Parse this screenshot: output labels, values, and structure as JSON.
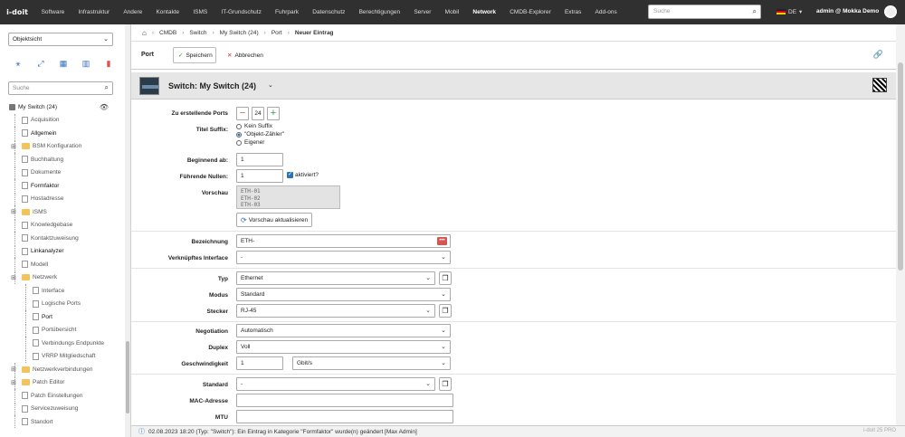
{
  "topbar": {
    "logo": "i-doit",
    "menu": [
      "Software",
      "Infrastruktur",
      "Andere",
      "Kontakte",
      "ISMS",
      "IT-Grundschutz",
      "Fuhrpark",
      "Datenschutz",
      "Berechtigungen",
      "Server",
      "Mobil",
      "Network",
      "CMDB-Explorer",
      "Extras",
      "Add-ons"
    ],
    "active": "Network",
    "search_placeholder": "Suche",
    "language": "DE",
    "user": "admin @ Mokka Demo"
  },
  "left": {
    "view_select": "Objektsicht",
    "search_placeholder": "Suche",
    "tree": [
      {
        "label": "My Switch (24)",
        "level": 0,
        "type": "root"
      },
      {
        "label": "Acquisition",
        "level": 1,
        "type": "file"
      },
      {
        "label": "Allgemein",
        "level": 1,
        "type": "file",
        "bold": true
      },
      {
        "label": "BSM Konfiguration",
        "level": 1,
        "type": "folder",
        "expand": true
      },
      {
        "label": "Buchhaltung",
        "level": 1,
        "type": "file"
      },
      {
        "label": "Dokumente",
        "level": 1,
        "type": "file"
      },
      {
        "label": "Formfaktor",
        "level": 1,
        "type": "file",
        "bold": true
      },
      {
        "label": "Hostadresse",
        "level": 1,
        "type": "file"
      },
      {
        "label": "ISMS",
        "level": 1,
        "type": "folder",
        "expand": true
      },
      {
        "label": "Knowledgebase",
        "level": 1,
        "type": "file"
      },
      {
        "label": "Kontaktzuweisung",
        "level": 1,
        "type": "file"
      },
      {
        "label": "Linkanalyzer",
        "level": 1,
        "type": "file",
        "bold": true
      },
      {
        "label": "Modell",
        "level": 1,
        "type": "file"
      },
      {
        "label": "Netzwerk",
        "level": 1,
        "type": "folder",
        "expand": true
      },
      {
        "label": "Interface",
        "level": 2,
        "type": "file"
      },
      {
        "label": "Logische Ports",
        "level": 2,
        "type": "file"
      },
      {
        "label": "Port",
        "level": 2,
        "type": "file",
        "bold": true
      },
      {
        "label": "Portübersicht",
        "level": 2,
        "type": "file"
      },
      {
        "label": "Verbindungs Endpunkte",
        "level": 2,
        "type": "file"
      },
      {
        "label": "VRRP Mitgliedschaft",
        "level": 2,
        "type": "file"
      },
      {
        "label": "Netzwerkverbindungen",
        "level": 1,
        "type": "folder",
        "expand": true
      },
      {
        "label": "Patch Editor",
        "level": 1,
        "type": "folder",
        "expand": true
      },
      {
        "label": "Patch Einstellungen",
        "level": 1,
        "type": "file"
      },
      {
        "label": "Servicezuweisung",
        "level": 1,
        "type": "file"
      },
      {
        "label": "Standort",
        "level": 1,
        "type": "file"
      }
    ]
  },
  "breadcrumb": [
    "CMDB",
    "Switch",
    "My Switch (24)",
    "Port",
    "Neuer Eintrag"
  ],
  "toolbar": {
    "title": "Port",
    "save": "Speichern",
    "cancel": "Abbrechen"
  },
  "object": {
    "title": "Switch: My Switch (24)"
  },
  "form": {
    "ports_label": "Zu erstellende Ports",
    "ports_value": "24",
    "suffix_label": "Titel Suffix:",
    "suffix_options": [
      "Kein Suffix",
      "\"Objekt-Zähler\"",
      "Eigener"
    ],
    "suffix_selected": 1,
    "begin_label": "Beginnend ab:",
    "begin_value": "1",
    "zeros_label": "Führende Nullen:",
    "zeros_value": "1",
    "zeros_check": "aktiviert?",
    "preview_label": "Vorschau",
    "preview_lines": [
      "ETH-01",
      "ETH-02",
      "ETH-03"
    ],
    "preview_button": "Vorschau aktualisieren",
    "name_label": "Bezeichnung",
    "name_value": "ETH-",
    "linked_label": "Verknüpftes Interface",
    "linked_value": "-",
    "type_label": "Typ",
    "type_value": "Ethernet",
    "mode_label": "Modus",
    "mode_value": "Standard",
    "plug_label": "Stecker",
    "plug_value": "RJ-45",
    "neg_label": "Negotiation",
    "neg_value": "Automatisch",
    "duplex_label": "Duplex",
    "duplex_value": "Voll",
    "speed_label": "Geschwindigkeit",
    "speed_value": "1",
    "speed_unit": "Gbit/s",
    "standard_label": "Standard",
    "standard_value": "-",
    "mac_label": "MAC-Adresse",
    "mac_value": "",
    "mtu_label": "MTU",
    "mtu_value": ""
  },
  "status": {
    "text": "02.08.2023 18:20 (Typ: \"Switch\"): Ein Eintrag in Kategorie \"Formfaktor\" wurde(n) geändert [Max Admin]",
    "version": "i-doit 25 PRO"
  },
  "colors": {
    "topbar": "#303030",
    "accent": "#2e72b8"
  }
}
